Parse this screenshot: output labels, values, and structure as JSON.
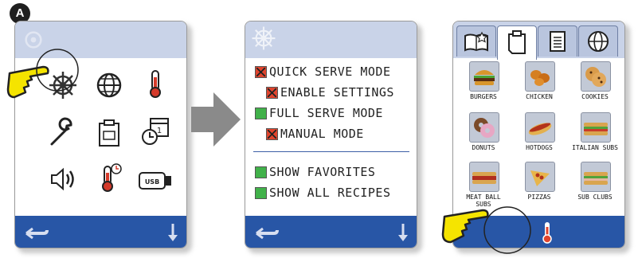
{
  "callout": {
    "label": "A"
  },
  "screen2": {
    "options": [
      {
        "label": "QUICK SERVE MODE",
        "state": "x",
        "indent": false
      },
      {
        "label": "ENABLE SETTINGS",
        "state": "x",
        "indent": true
      },
      {
        "label": "FULL SERVE MODE",
        "state": "check",
        "indent": false
      },
      {
        "label": "MANUAL MODE",
        "state": "x",
        "indent": true
      },
      {
        "label": "SHOW FAVORITES",
        "state": "check",
        "indent": false
      },
      {
        "label": "SHOW ALL RECIPES",
        "state": "check",
        "indent": false
      }
    ]
  },
  "screen3": {
    "tiles": [
      {
        "label": "BURGERS"
      },
      {
        "label": "CHICKEN"
      },
      {
        "label": "COOKIES"
      },
      {
        "label": "DONUTS"
      },
      {
        "label": "HOTDOGS"
      },
      {
        "label": "ITALIAN SUBS"
      },
      {
        "label": "MEAT BALL SUBS"
      },
      {
        "label": "PIZZAS"
      },
      {
        "label": "SUB CLUBS"
      }
    ]
  },
  "colors": {
    "accent": "#2856a6",
    "band": "#c9d3e8",
    "pointer": "#f5e400"
  }
}
